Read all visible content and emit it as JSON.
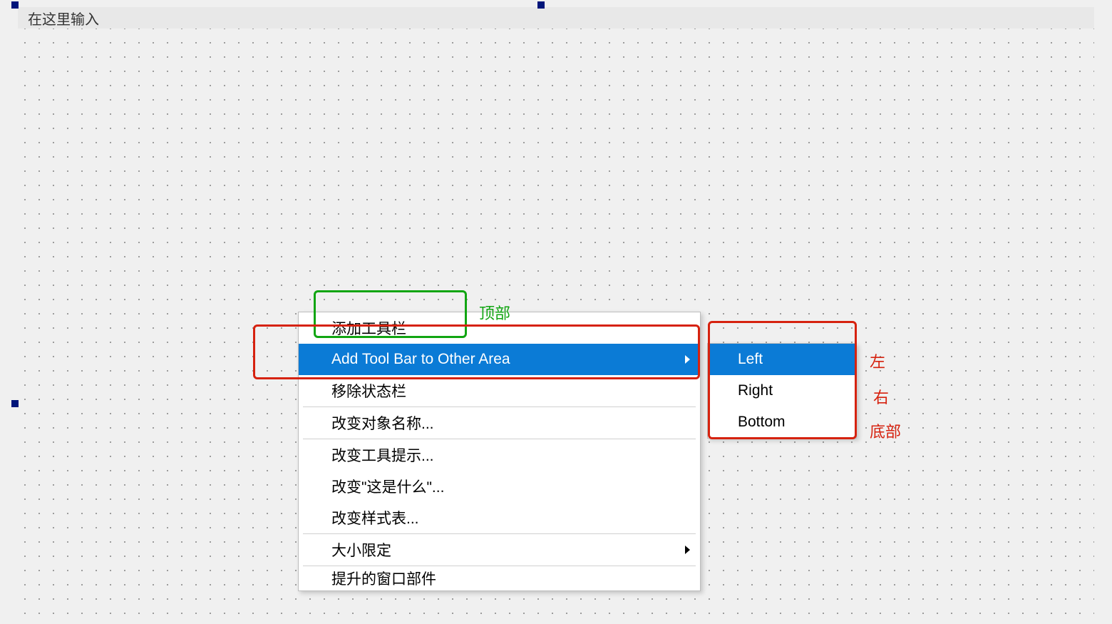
{
  "menu_strip": {
    "prompt": "在这里输入"
  },
  "context_menu": {
    "add_toolbar": "添加工具栏",
    "add_toolbar_other": "Add Tool Bar to Other Area",
    "remove_statusbar": "移除状态栏",
    "change_object_name": "改变对象名称...",
    "change_tooltip": "改变工具提示...",
    "change_whats_this": "改变\"这是什么\"...",
    "change_stylesheet": "改变样式表...",
    "size_limit": "大小限定",
    "promote_widget": "提升的窗口部件"
  },
  "submenu": {
    "left": "Left",
    "right": "Right",
    "bottom": "Bottom"
  },
  "annotations": {
    "top": "顶部",
    "left": "左",
    "right": "右",
    "bottom": "底部"
  }
}
